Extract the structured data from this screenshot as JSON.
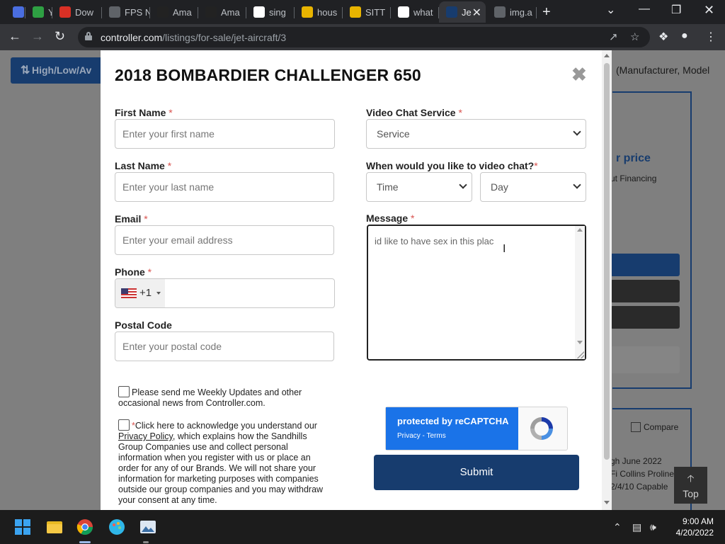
{
  "browser": {
    "tabs": [
      {
        "label": "",
        "favicon": "video-icon",
        "color": "#4a6ee0"
      },
      {
        "label": "Y",
        "favicon": "check-icon",
        "color": "#2ea043"
      },
      {
        "label": "Dow",
        "favicon": "download-icon",
        "color": "#d93025"
      },
      {
        "label": "FPS N",
        "favicon": "globe-icon",
        "color": "#5f6368"
      },
      {
        "label": "Ama",
        "favicon": "amazon-icon",
        "color": "#222222"
      },
      {
        "label": "Ama",
        "favicon": "amazon-icon",
        "color": "#222222"
      },
      {
        "label": "sing",
        "favicon": "google-icon",
        "color": "#ffffff"
      },
      {
        "label": "hous",
        "favicon": "bar-icon",
        "color": "#e8b400"
      },
      {
        "label": "SITT",
        "favicon": "bar-icon",
        "color": "#e8b400"
      },
      {
        "label": "what",
        "favicon": "google-icon",
        "color": "#ffffff"
      },
      {
        "label": "Je",
        "favicon": "controller-icon",
        "color": "#173c6e",
        "active": true
      },
      {
        "label": "img.a",
        "favicon": "globe-icon",
        "color": "#5f6368"
      }
    ],
    "url_host": "controller.com",
    "url_path": "/listings/for-sale/jet-aircraft/3"
  },
  "background": {
    "sort_label": "High/Low/Av",
    "search_placeholder": "(Manufacturer, Model",
    "price_label": "r price",
    "financing_label": "ut Financing",
    "compare_label": "Compare",
    "line1": "gh June 2022",
    "line2": "Fi Collins Proline",
    "line3": "2/4/10 Capable",
    "top_label": "Top"
  },
  "modal": {
    "title": "2018 BOMBARDIER CHALLENGER 650",
    "first_name": {
      "label": "First Name",
      "placeholder": "Enter your first name"
    },
    "last_name": {
      "label": "Last Name",
      "placeholder": "Enter your last name"
    },
    "email": {
      "label": "Email",
      "placeholder": "Enter your email address"
    },
    "phone": {
      "label": "Phone",
      "dial_code": "+1"
    },
    "postal": {
      "label": "Postal Code",
      "placeholder": "Enter your postal code"
    },
    "video_service": {
      "label": "Video Chat Service",
      "value": "Service"
    },
    "video_when": {
      "label": "When would you like to video chat?",
      "time_value": "Time",
      "day_value": "Day"
    },
    "message": {
      "label": "Message",
      "value": "id like to have sex in this plac"
    },
    "required_mark": "*",
    "updates_checkbox": "Please send me Weekly Updates and other occasional news from Controller.com.",
    "ack_prefix": "Click here to acknowledge you understand our ",
    "privacy_link": "Privacy Policy",
    "ack_suffix": ", which explains how the Sandhills Group Companies use and collect personal information when you register with us or place an order for any of our Brands. We will not share your information for marketing purposes with companies outside our group companies and you may withdraw your consent at any time.",
    "recaptcha_title": "protected by reCAPTCHA",
    "recaptcha_links": "Privacy - Terms",
    "submit_label": "Submit"
  },
  "taskbar": {
    "time": "9:00 AM",
    "date": "4/20/2022"
  },
  "colors": {
    "brand_navy": "#173c6e",
    "required_red": "#d9534f",
    "recaptcha_blue": "#1a73e8"
  }
}
